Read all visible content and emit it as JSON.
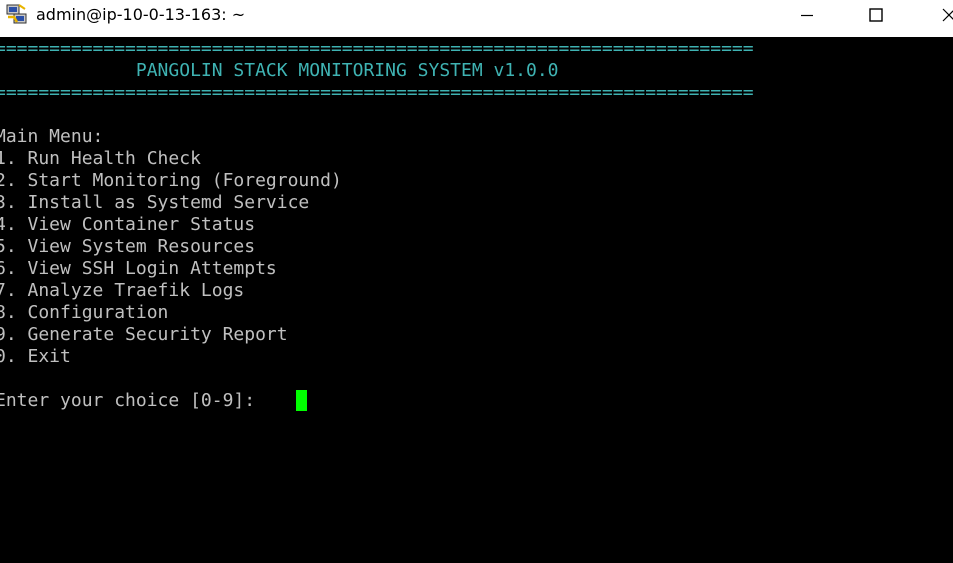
{
  "window": {
    "title": "admin@ip-10-0-13-163: ~",
    "icon": "putty-terminal-icon",
    "controls": [
      "minimize-icon",
      "maximize-icon",
      "close-icon"
    ]
  },
  "terminal": {
    "separator": "======================================================================",
    "banner": "             PANGOLIN STACK MONITORING SYSTEM v1.0.0",
    "menu_header": "Main Menu:",
    "menu_items": [
      "1. Run Health Check",
      "2. Start Monitoring (Foreground)",
      "3. Install as Systemd Service",
      "4. View Container Status",
      "5. View System Resources",
      "6. View SSH Login Attempts",
      "7. Analyze Traefik Logs",
      "8. Configuration",
      "9. Generate Security Report",
      "0. Exit"
    ],
    "prompt": "Enter your choice [0-9]: ",
    "colors": {
      "banner": "#3fb3b3",
      "text": "#c0c0c0",
      "cursor": "#00ff00",
      "background": "#000000"
    }
  }
}
